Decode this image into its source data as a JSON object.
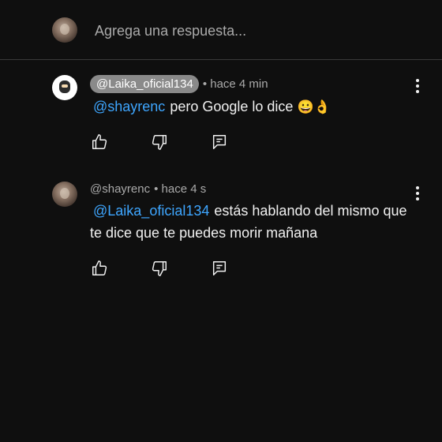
{
  "reply_bar": {
    "placeholder": "Agrega una respuesta..."
  },
  "comments": [
    {
      "handle": "@Laika_oficial134",
      "time": "• hace 4 min",
      "mention": "@shayrenc",
      "text": "pero Google lo dice",
      "emojis": "😀👌",
      "avatar_icon": "character-avatar-icon"
    },
    {
      "handle": "@shayrenc",
      "time": "• hace 4 s",
      "mention": "@Laika_oficial134",
      "text": "estás hablando del mismo que te dice que te puedes morir mañana",
      "avatar_icon": "user-photo-avatar-icon"
    }
  ],
  "colors": {
    "background": "#0f0f0f",
    "mention": "#3ea6ff",
    "muted": "#aaaaaa",
    "chip": "#8a8a8a"
  }
}
